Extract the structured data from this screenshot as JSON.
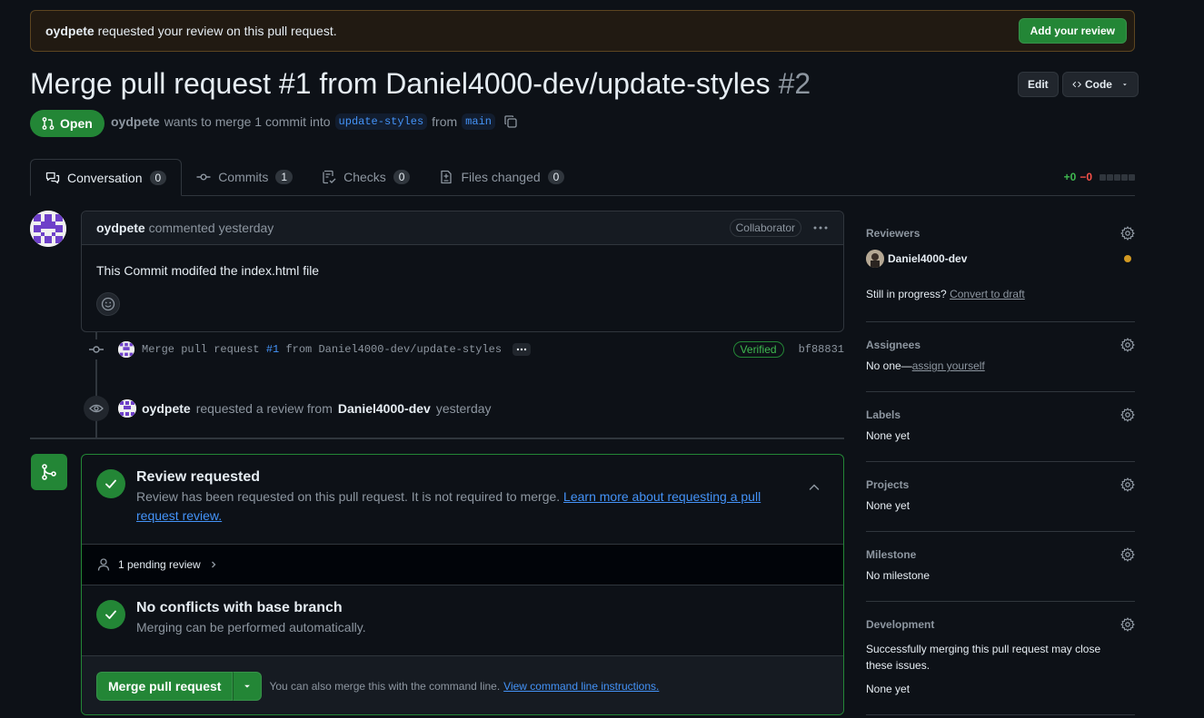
{
  "banner": {
    "user": "oydpete",
    "text": "requested your review on this pull request.",
    "button": "Add your review"
  },
  "header": {
    "title": "Merge pull request #1 from Daniel4000-dev/update-styles",
    "number": "#2",
    "edit_label": "Edit",
    "code_label": "Code"
  },
  "state": {
    "label": "Open",
    "author": "oydpete",
    "text1": "wants to merge 1 commit into",
    "base_branch": "update-styles",
    "text2": "from",
    "head_branch": "main"
  },
  "tabs": [
    {
      "label": "Conversation",
      "count": "0"
    },
    {
      "label": "Commits",
      "count": "1"
    },
    {
      "label": "Checks",
      "count": "0"
    },
    {
      "label": "Files changed",
      "count": "0"
    }
  ],
  "diffstat": {
    "add": "+0",
    "del": "−0"
  },
  "comment": {
    "author": "oydpete",
    "when": "commented yesterday",
    "badge": "Collaborator",
    "body": "This Commit modifed the index.html file"
  },
  "commit": {
    "message_prefix": "Merge pull request",
    "pr_ref": "#1",
    "message_suffix": "from Daniel4000-dev/update-styles",
    "verified": "Verified",
    "sha": "bf88831"
  },
  "review_event": {
    "actor": "oydpete",
    "text": "requested a review from",
    "target": "Daniel4000-dev",
    "when": "yesterday"
  },
  "mergebox": {
    "review_title": "Review requested",
    "review_desc": "Review has been requested on this pull request. It is not required to merge.",
    "review_link": "Learn more about requesting a pull request review.",
    "pending": "1 pending review",
    "conflicts_title": "No conflicts with base branch",
    "conflicts_desc": "Merging can be performed automatically.",
    "merge_button": "Merge pull request",
    "cli_text": "You can also merge this with the command line.",
    "cli_link": "View command line instructions."
  },
  "sidebar": {
    "reviewers": {
      "heading": "Reviewers",
      "name": "Daniel4000-dev",
      "progress_text": "Still in progress?",
      "draft_link": "Convert to draft"
    },
    "assignees": {
      "heading": "Assignees",
      "value": "No one—",
      "link": "assign yourself"
    },
    "labels": {
      "heading": "Labels",
      "value": "None yet"
    },
    "projects": {
      "heading": "Projects",
      "value": "None yet"
    },
    "milestone": {
      "heading": "Milestone",
      "value": "No milestone"
    },
    "development": {
      "heading": "Development",
      "desc": "Successfully merging this pull request may close these issues.",
      "value": "None yet"
    }
  },
  "colors": {
    "accent_green": "#238636",
    "link_blue": "#4493f8",
    "background": "#0d1117",
    "pending_dot": "#d29922"
  }
}
